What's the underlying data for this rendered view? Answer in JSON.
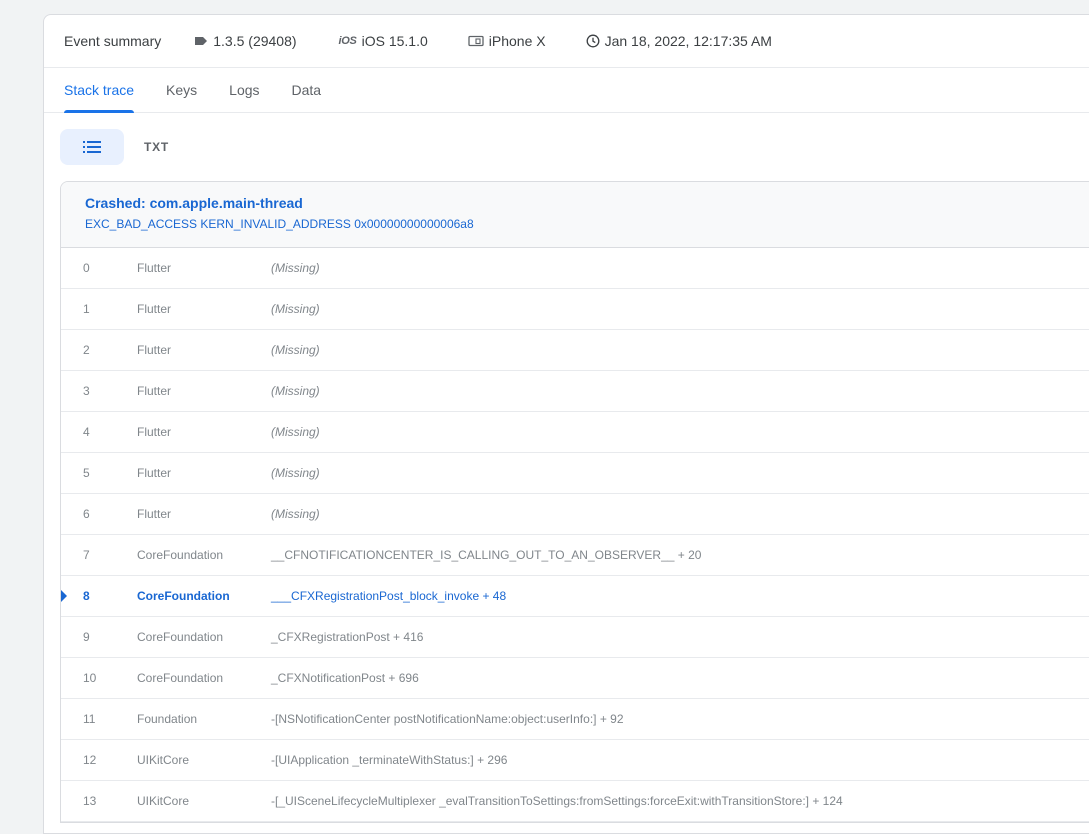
{
  "summary": {
    "title": "Event summary",
    "version": "1.3.5 (29408)",
    "os_badge": "iOS",
    "os": "iOS 15.1.0",
    "device": "iPhone X",
    "timestamp": "Jan 18, 2022, 12:17:35 AM"
  },
  "tabs": [
    {
      "label": "Stack trace",
      "active": true
    },
    {
      "label": "Keys",
      "active": false
    },
    {
      "label": "Logs",
      "active": false
    },
    {
      "label": "Data",
      "active": false
    }
  ],
  "view_toggle": {
    "txt_label": "TXT"
  },
  "crash": {
    "title": "Crashed: com.apple.main-thread",
    "detail": "EXC_BAD_ACCESS KERN_INVALID_ADDRESS 0x00000000000006a8"
  },
  "frames": [
    {
      "num": "0",
      "lib": "Flutter",
      "symbol": "(Missing)",
      "missing": true
    },
    {
      "num": "1",
      "lib": "Flutter",
      "symbol": "(Missing)",
      "missing": true
    },
    {
      "num": "2",
      "lib": "Flutter",
      "symbol": "(Missing)",
      "missing": true
    },
    {
      "num": "3",
      "lib": "Flutter",
      "symbol": "(Missing)",
      "missing": true
    },
    {
      "num": "4",
      "lib": "Flutter",
      "symbol": "(Missing)",
      "missing": true
    },
    {
      "num": "5",
      "lib": "Flutter",
      "symbol": "(Missing)",
      "missing": true
    },
    {
      "num": "6",
      "lib": "Flutter",
      "symbol": "(Missing)",
      "missing": true
    },
    {
      "num": "7",
      "lib": "CoreFoundation",
      "symbol": "__CFNOTIFICATIONCENTER_IS_CALLING_OUT_TO_AN_OBSERVER__ + 20"
    },
    {
      "num": "8",
      "lib": "CoreFoundation",
      "symbol": "___CFXRegistrationPost_block_invoke + 48",
      "highlight": true
    },
    {
      "num": "9",
      "lib": "CoreFoundation",
      "symbol": "_CFXRegistrationPost + 416"
    },
    {
      "num": "10",
      "lib": "CoreFoundation",
      "symbol": "_CFXNotificationPost + 696"
    },
    {
      "num": "11",
      "lib": "Foundation",
      "symbol": "-[NSNotificationCenter postNotificationName:object:userInfo:] + 92"
    },
    {
      "num": "12",
      "lib": "UIKitCore",
      "symbol": "-[UIApplication _terminateWithStatus:] + 296"
    },
    {
      "num": "13",
      "lib": "UIKitCore",
      "symbol": "-[_UISceneLifecycleMultiplexer _evalTransitionToSettings:fromSettings:forceExit:withTransitionStore:] + 124"
    }
  ],
  "colors": {
    "accent": "#1a73e8",
    "crash_text": "#1967d2",
    "active_toggle_bg": "#e8f0fe"
  }
}
